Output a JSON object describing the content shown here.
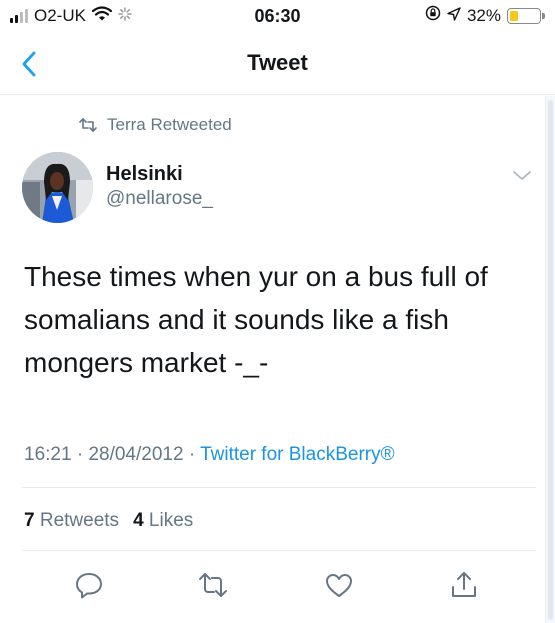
{
  "status_bar": {
    "carrier": "O2-UK",
    "time": "06:30",
    "battery_percent": "32%",
    "battery_level": 0.32,
    "icons": [
      "signal-icon",
      "wifi-icon",
      "activity-icon",
      "lock-rotation-icon",
      "location-icon",
      "battery-icon"
    ]
  },
  "nav": {
    "title": "Tweet",
    "back_icon": "chevron-left-icon"
  },
  "tweet": {
    "retweeted_by": "Terra Retweeted",
    "author_name": "Helsinki",
    "author_handle": "@nellarose_",
    "text_lines": [
      "These times when yur on a bus full of",
      "somalians and it sounds like a fish",
      "mongers market -_-"
    ],
    "time": "16:21",
    "date": "28/04/2012",
    "source": "Twitter for BlackBerry®",
    "separator": "·",
    "retweets_count": "7",
    "retweets_label": "Retweets",
    "likes_count": "4",
    "likes_label": "Likes"
  },
  "colors": {
    "accent": "#1b95e0",
    "muted": "#657786",
    "text": "#14171a",
    "divider": "#e6ecf0",
    "avatar_jacket": "#1d5bd6"
  },
  "actions": [
    "reply-icon",
    "retweet-icon",
    "like-icon",
    "share-icon"
  ]
}
